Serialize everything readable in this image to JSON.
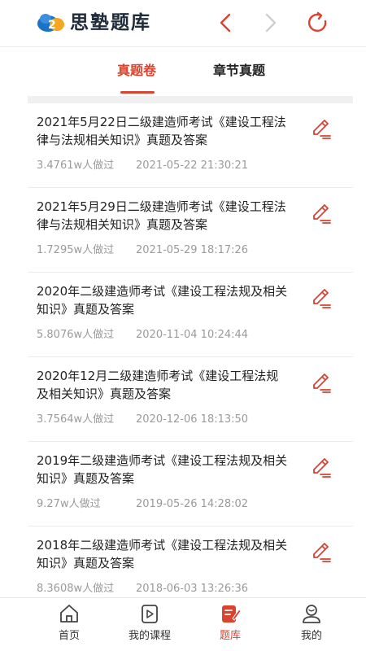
{
  "header": {
    "brand": "思塾题库"
  },
  "tabs": [
    {
      "label": "真题卷",
      "active": true
    },
    {
      "label": "章节真题",
      "active": false
    }
  ],
  "items": [
    {
      "title": "2021年5月22日二级建造师考试《建设工程法律与法规相关知识》真题及答案",
      "count": "3.4761w人做过",
      "date": "2021-05-22 21:30:21"
    },
    {
      "title": "2021年5月29日二级建造师考试《建设工程法律与法规相关知识》真题及答案",
      "count": "1.7295w人做过",
      "date": "2021-05-29 18:17:26"
    },
    {
      "title": "2020年二级建造师考试《建设工程法规及相关知识》真题及答案",
      "count": "5.8076w人做过",
      "date": "2020-11-04 10:24:44"
    },
    {
      "title": "2020年12月二级建造师考试《建设工程法规及相关知识》真题及答案",
      "count": "3.7564w人做过",
      "date": "2020-12-06 18:13:50"
    },
    {
      "title": "2019年二级建造师考试《建设工程法规及相关知识》真题及答案",
      "count": "9.27w人做过",
      "date": "2019-05-26 14:28:02"
    },
    {
      "title": "2018年二级建造师考试《建设工程法规及相关知识》真题及答案",
      "count": "8.3608w人做过",
      "date": "2018-06-03 13:26:36"
    }
  ],
  "bottom_nav": [
    {
      "label": "首页",
      "icon": "home-icon",
      "active": false
    },
    {
      "label": "我的课程",
      "icon": "play-icon",
      "active": false
    },
    {
      "label": "题库",
      "icon": "question-bank-icon",
      "active": true
    },
    {
      "label": "我的",
      "icon": "user-icon",
      "active": false
    }
  ],
  "colors": {
    "accent": "#d9432f",
    "brand_blue": "#1a73c9",
    "brand_orange": "#f5a623"
  }
}
